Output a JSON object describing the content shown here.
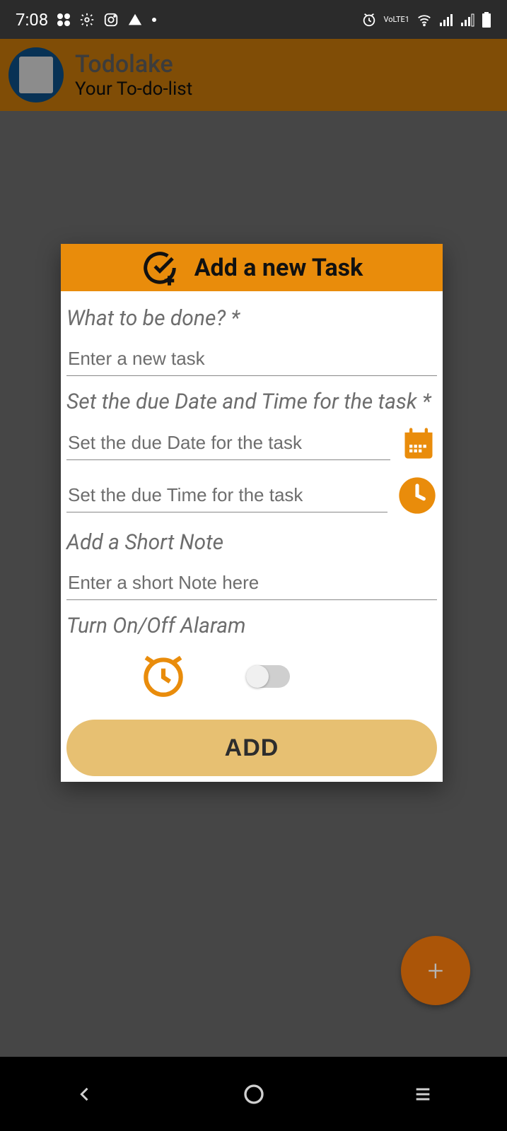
{
  "status": {
    "time": "7:08",
    "lte_label": "VoLTE1"
  },
  "app": {
    "title": "Todolake",
    "subtitle": "Your To-do-list"
  },
  "dialog": {
    "title": "Add a new Task",
    "task_label": "What to be done? *",
    "task_placeholder": "Enter a new task",
    "datetime_label": "Set the due Date and Time for the task *",
    "date_placeholder": "Set the due Date for the task",
    "time_placeholder": "Set the due Time for the task",
    "note_label": "Add a Short Note",
    "note_placeholder": "Enter a short Note here",
    "alarm_label": "Turn On/Off Alaram",
    "add_button": "ADD"
  },
  "fab": {
    "label": "+"
  },
  "colors": {
    "accent": "#e98c0b",
    "accent_dark": "#ab5508"
  }
}
